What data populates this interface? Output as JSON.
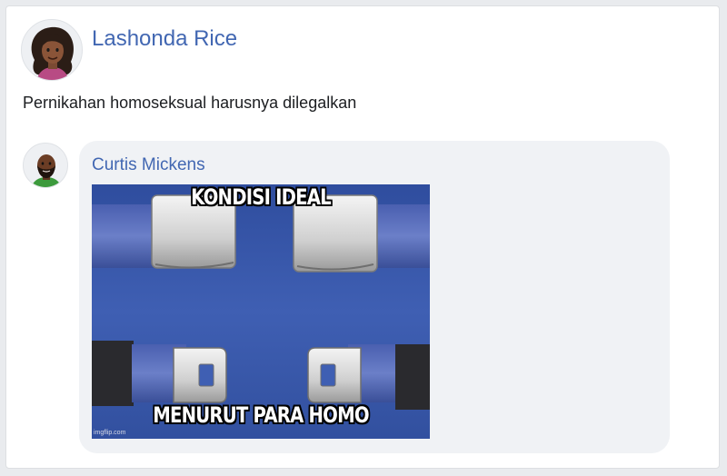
{
  "post": {
    "author": "Lashonda Rice",
    "text": "Pernikahan homoseksual harusnya dilegalkan"
  },
  "comment": {
    "author": "Curtis Mickens",
    "meme": {
      "top_caption": "KONDISI IDEAL",
      "bottom_caption": "MENURUT PARA HOMO",
      "watermark": "imgflip.com"
    }
  },
  "colors": {
    "link": "#4267b2",
    "bubble": "#f0f2f5",
    "meme_background": "#3d5aa8"
  }
}
